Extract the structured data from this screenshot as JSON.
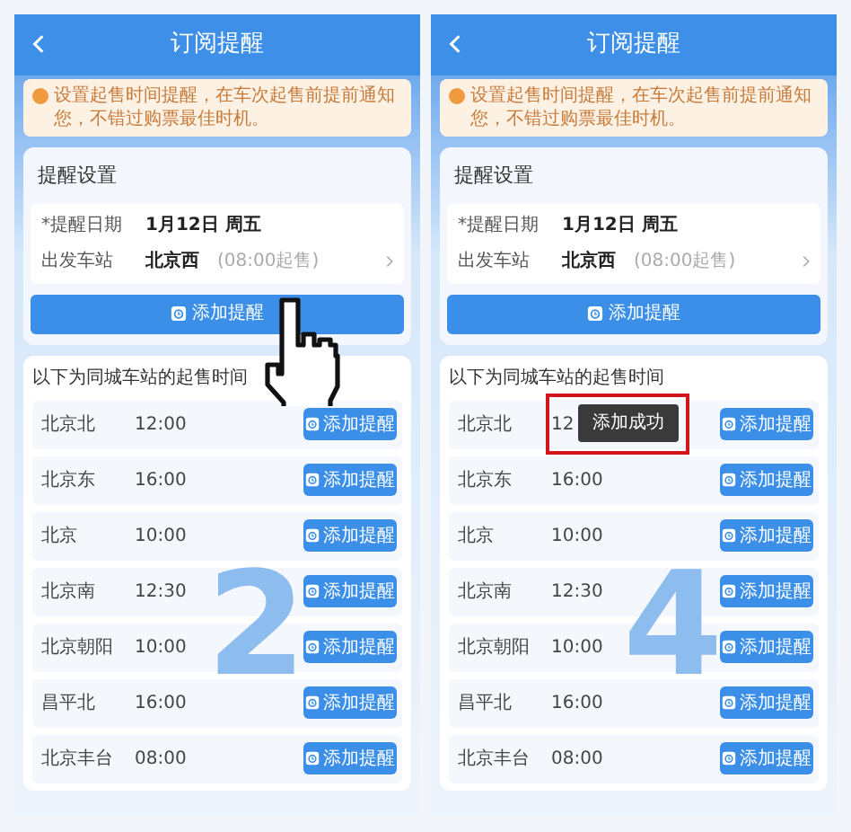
{
  "panels": [
    {
      "title": "订阅提醒",
      "notice": "设置起售时间提醒，在车次起售前提前通知您，不错过购票最佳时机。",
      "settings": {
        "heading": "提醒设置",
        "fields": [
          {
            "label": "*提醒日期",
            "value": "1月12日 周五"
          },
          {
            "label": "出发车站",
            "value": "北京西",
            "hint": "(08:00起售)"
          }
        ],
        "button": "添加提醒"
      },
      "list": {
        "heading": "以下为同城车站的起售时间",
        "rows": [
          {
            "station": "北京北",
            "time": "12:00",
            "button": "添加提醒"
          },
          {
            "station": "北京东",
            "time": "16:00",
            "button": "添加提醒"
          },
          {
            "station": "北京",
            "time": "10:00",
            "button": "添加提醒"
          },
          {
            "station": "北京南",
            "time": "12:30",
            "button": "添加提醒"
          },
          {
            "station": "北京朝阳",
            "time": "10:00",
            "button": "添加提醒"
          },
          {
            "station": "昌平北",
            "time": "16:00",
            "button": "添加提醒"
          },
          {
            "station": "北京丰台",
            "time": "08:00",
            "button": "添加提醒"
          }
        ]
      },
      "step": "2",
      "pointer": true
    },
    {
      "title": "订阅提醒",
      "notice": "设置起售时间提醒，在车次起售前提前通知您，不错过购票最佳时机。",
      "settings": {
        "heading": "提醒设置",
        "fields": [
          {
            "label": "*提醒日期",
            "value": "1月12日 周五"
          },
          {
            "label": "出发车站",
            "value": "北京西",
            "hint": "(08:00起售)"
          }
        ],
        "button": "添加提醒"
      },
      "list": {
        "heading": "以下为同城车站的起售时间",
        "rows": [
          {
            "station": "北京北",
            "time": "12",
            "button": "添加提醒",
            "toast": "添加成功"
          },
          {
            "station": "北京东",
            "time": "16:00",
            "button": "添加提醒"
          },
          {
            "station": "北京",
            "time": "10:00",
            "button": "添加提醒"
          },
          {
            "station": "北京南",
            "time": "12:30",
            "button": "添加提醒"
          },
          {
            "station": "北京朝阳",
            "time": "10:00",
            "button": "添加提醒"
          },
          {
            "station": "昌平北",
            "time": "16:00",
            "button": "添加提醒"
          },
          {
            "station": "北京丰台",
            "time": "08:00",
            "button": "添加提醒"
          }
        ]
      },
      "step": "4",
      "pointer": false
    }
  ]
}
